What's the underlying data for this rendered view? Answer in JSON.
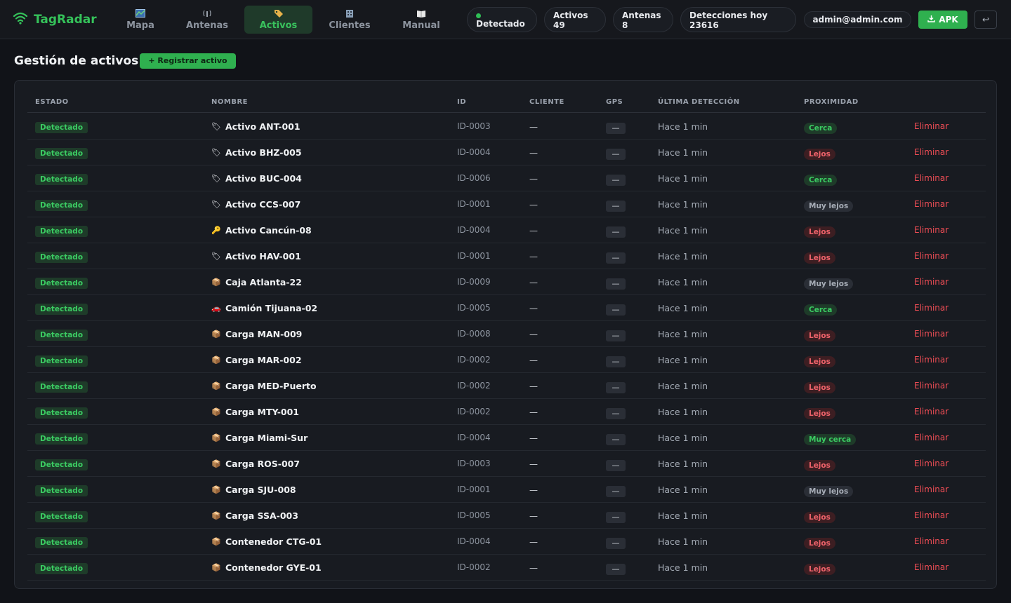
{
  "app": {
    "brand": "TagRadar",
    "tabs": [
      {
        "label": "Mapa",
        "icon": "map-icon"
      },
      {
        "label": "Antenas",
        "icon": "antenna-icon"
      },
      {
        "label": "Activos",
        "icon": "tag-icon",
        "active": true
      },
      {
        "label": "Clientes",
        "icon": "building-icon"
      },
      {
        "label": "Manual",
        "icon": "book-icon"
      }
    ],
    "status": {
      "detectado_label": "Detectado",
      "activos_label": "Activos",
      "activos_value": "49",
      "antenas_label": "Antenas",
      "antenas_value": "8",
      "detecciones_label": "Detecciones hoy",
      "detecciones_value": "23616"
    },
    "user_email": "admin@admin.com",
    "apk_label": "APK",
    "logout_symbol": "↩"
  },
  "page": {
    "title": "Gestión de activos",
    "register_label": "+ Registrar activo"
  },
  "table": {
    "columns": [
      "ESTADO",
      "NOMBRE",
      "ID",
      "CLIENTE",
      "GPS",
      "ÚLTIMA DETECCIÓN",
      "PROXIMIDAD"
    ],
    "delete_label": "Eliminar",
    "rows": [
      {
        "estado": "Detectado",
        "icon": "tag-icon",
        "nombre": "Activo ANT-001",
        "id": "ID-0003",
        "cliente": "—",
        "gps": "—",
        "ultima": "Hace 1 min",
        "prox": "Cerca"
      },
      {
        "estado": "Detectado",
        "icon": "tag-icon",
        "nombre": "Activo BHZ-005",
        "id": "ID-0004",
        "cliente": "—",
        "gps": "—",
        "ultima": "Hace 1 min",
        "prox": "Lejos"
      },
      {
        "estado": "Detectado",
        "icon": "tag-icon",
        "nombre": "Activo BUC-004",
        "id": "ID-0006",
        "cliente": "—",
        "gps": "—",
        "ultima": "Hace 1 min",
        "prox": "Cerca"
      },
      {
        "estado": "Detectado",
        "icon": "tag-icon",
        "nombre": "Activo CCS-007",
        "id": "ID-0001",
        "cliente": "—",
        "gps": "—",
        "ultima": "Hace 1 min",
        "prox": "Muy lejos"
      },
      {
        "estado": "Detectado",
        "icon": "key-icon",
        "nombre": "Activo Cancún-08",
        "id": "ID-0004",
        "cliente": "—",
        "gps": "—",
        "ultima": "Hace 1 min",
        "prox": "Lejos"
      },
      {
        "estado": "Detectado",
        "icon": "tag-icon",
        "nombre": "Activo HAV-001",
        "id": "ID-0001",
        "cliente": "—",
        "gps": "—",
        "ultima": "Hace 1 min",
        "prox": "Lejos"
      },
      {
        "estado": "Detectado",
        "icon": "package-icon",
        "nombre": "Caja Atlanta-22",
        "id": "ID-0009",
        "cliente": "—",
        "gps": "—",
        "ultima": "Hace 1 min",
        "prox": "Muy lejos"
      },
      {
        "estado": "Detectado",
        "icon": "car-icon",
        "nombre": "Camión Tijuana-02",
        "id": "ID-0005",
        "cliente": "—",
        "gps": "—",
        "ultima": "Hace 1 min",
        "prox": "Cerca"
      },
      {
        "estado": "Detectado",
        "icon": "package-icon",
        "nombre": "Carga MAN-009",
        "id": "ID-0008",
        "cliente": "—",
        "gps": "—",
        "ultima": "Hace 1 min",
        "prox": "Lejos"
      },
      {
        "estado": "Detectado",
        "icon": "package-icon",
        "nombre": "Carga MAR-002",
        "id": "ID-0002",
        "cliente": "—",
        "gps": "—",
        "ultima": "Hace 1 min",
        "prox": "Lejos"
      },
      {
        "estado": "Detectado",
        "icon": "package-icon",
        "nombre": "Carga MED-Puerto",
        "id": "ID-0002",
        "cliente": "—",
        "gps": "—",
        "ultima": "Hace 1 min",
        "prox": "Lejos"
      },
      {
        "estado": "Detectado",
        "icon": "package-icon",
        "nombre": "Carga MTY-001",
        "id": "ID-0002",
        "cliente": "—",
        "gps": "—",
        "ultima": "Hace 1 min",
        "prox": "Lejos"
      },
      {
        "estado": "Detectado",
        "icon": "package-icon",
        "nombre": "Carga Miami-Sur",
        "id": "ID-0004",
        "cliente": "—",
        "gps": "—",
        "ultima": "Hace 1 min",
        "prox": "Muy cerca"
      },
      {
        "estado": "Detectado",
        "icon": "package-icon",
        "nombre": "Carga ROS-007",
        "id": "ID-0003",
        "cliente": "—",
        "gps": "—",
        "ultima": "Hace 1 min",
        "prox": "Lejos"
      },
      {
        "estado": "Detectado",
        "icon": "package-icon",
        "nombre": "Carga SJU-008",
        "id": "ID-0001",
        "cliente": "—",
        "gps": "—",
        "ultima": "Hace 1 min",
        "prox": "Muy lejos"
      },
      {
        "estado": "Detectado",
        "icon": "package-icon",
        "nombre": "Carga SSA-003",
        "id": "ID-0005",
        "cliente": "—",
        "gps": "—",
        "ultima": "Hace 1 min",
        "prox": "Lejos"
      },
      {
        "estado": "Detectado",
        "icon": "package-icon",
        "nombre": "Contenedor CTG-01",
        "id": "ID-0004",
        "cliente": "—",
        "gps": "—",
        "ultima": "Hace 1 min",
        "prox": "Lejos"
      },
      {
        "estado": "Detectado",
        "icon": "package-icon",
        "nombre": "Contenedor GYE-01",
        "id": "ID-0002",
        "cliente": "—",
        "gps": "—",
        "ultima": "Hace 1 min",
        "prox": "Lejos"
      }
    ]
  },
  "colors": {
    "accent": "#2fb04f",
    "background": "#111318",
    "danger": "#ef4d55"
  }
}
